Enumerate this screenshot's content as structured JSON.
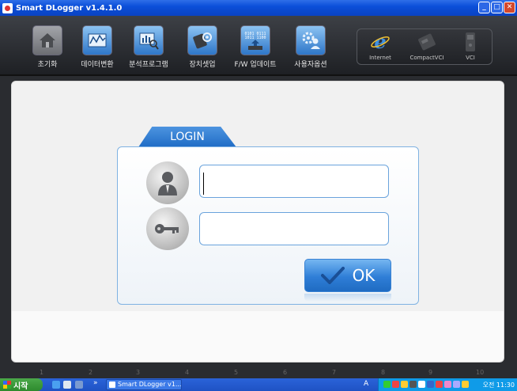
{
  "window": {
    "title": "Smart DLogger v1.4.1.0"
  },
  "toolbar": {
    "items": [
      {
        "label": "초기화",
        "icon": "home-icon"
      },
      {
        "label": "데이터변환",
        "icon": "data-convert-icon"
      },
      {
        "label": "분석프로그램",
        "icon": "analysis-icon"
      },
      {
        "label": "장치셋업",
        "icon": "device-setup-icon"
      },
      {
        "label": "F/W 업데이트",
        "icon": "firmware-update-icon"
      },
      {
        "label": "사용자옵션",
        "icon": "user-options-icon"
      }
    ],
    "right_items": [
      {
        "label": "Internet",
        "icon": "internet-explorer-icon"
      },
      {
        "label": "CompactVCI",
        "icon": "compact-vci-icon"
      },
      {
        "label": "VCI",
        "icon": "vci-icon"
      }
    ]
  },
  "login": {
    "tab_label": "LOGIN",
    "username_value": "",
    "password_value": "",
    "ok_label": "OK"
  },
  "pages": [
    "1",
    "2",
    "3",
    "4",
    "5",
    "6",
    "7",
    "8",
    "9",
    "10"
  ],
  "taskbar": {
    "start_label": "시작",
    "task_label": "Smart DLogger v1....",
    "ime": "A",
    "clock": "오전 11:30"
  },
  "colors": {
    "accent": "#2f7ed7",
    "titlebar": "#0b4fd9",
    "toolbar": "#2a2c30"
  }
}
